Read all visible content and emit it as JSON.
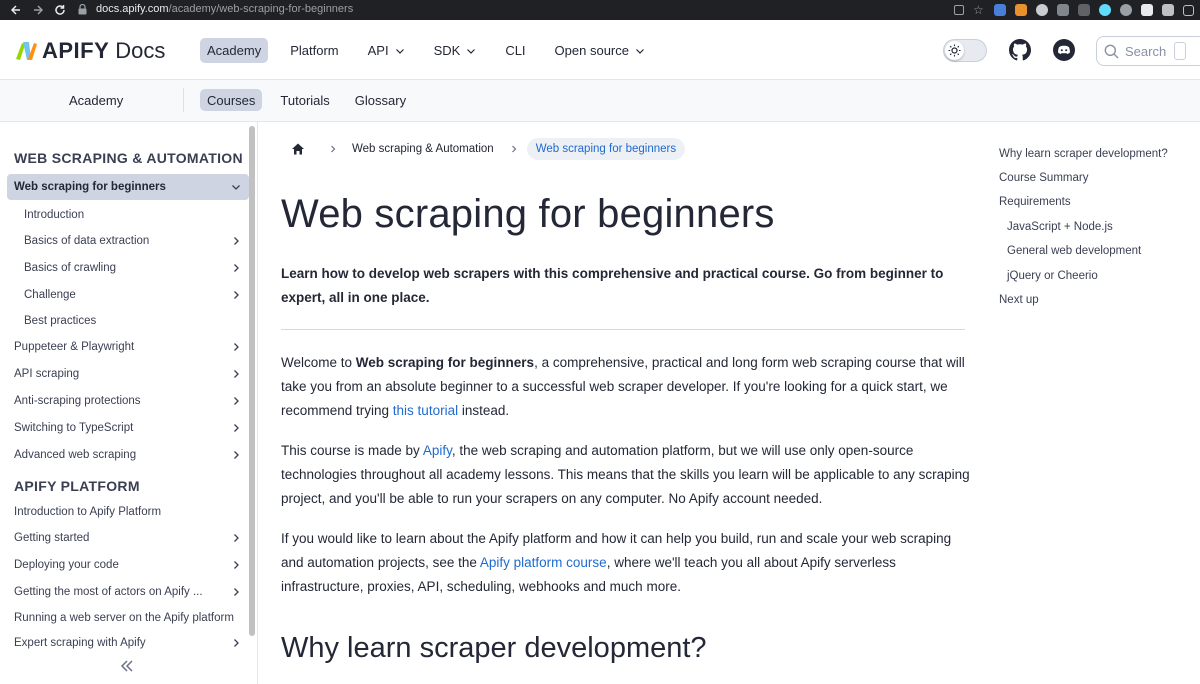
{
  "browser": {
    "url_host": "docs.apify.com",
    "url_path": "/academy/web-scraping-for-beginners"
  },
  "navbar": {
    "logo_text": "APIFY",
    "logo_docs": "Docs",
    "items": [
      {
        "label": "Academy",
        "dropdown": false
      },
      {
        "label": "Platform",
        "dropdown": false
      },
      {
        "label": "API",
        "dropdown": true
      },
      {
        "label": "SDK",
        "dropdown": true
      },
      {
        "label": "CLI",
        "dropdown": false
      },
      {
        "label": "Open source",
        "dropdown": true
      }
    ],
    "search_placeholder": "Search"
  },
  "subnav": {
    "title": "Academy",
    "items": [
      "Courses",
      "Tutorials",
      "Glossary"
    ]
  },
  "sidebar": {
    "section1": "WEB SCRAPING & AUTOMATION",
    "section2": "APIFY PLATFORM",
    "items": [
      {
        "label": "Web scraping for beginners"
      },
      {
        "label": "Introduction"
      },
      {
        "label": "Basics of data extraction"
      },
      {
        "label": "Basics of crawling"
      },
      {
        "label": "Challenge"
      },
      {
        "label": "Best practices"
      },
      {
        "label": "Puppeteer & Playwright"
      },
      {
        "label": "API scraping"
      },
      {
        "label": "Anti-scraping protections"
      },
      {
        "label": "Switching to TypeScript"
      },
      {
        "label": "Advanced web scraping"
      },
      {
        "label": "Introduction to Apify Platform"
      },
      {
        "label": "Getting started"
      },
      {
        "label": "Deploying your code"
      },
      {
        "label": "Getting the most of actors on Apify ..."
      },
      {
        "label": "Running a web server on the Apify platform"
      },
      {
        "label": "Expert scraping with Apify"
      }
    ]
  },
  "breadcrumbs": {
    "section": "Web scraping & Automation",
    "current": "Web scraping for beginners"
  },
  "content": {
    "title": "Web scraping for beginners",
    "lead": "Learn how to develop web scrapers with this comprehensive and practical course. Go from beginner to expert, all in one place.",
    "p1_a": "Welcome to ",
    "p1_b": "Web scraping for beginners",
    "p1_c": ", a comprehensive, practical and long form web scraping course that will take you from an absolute beginner to a successful web scraper developer. If you're looking for a quick start, we recommend trying ",
    "p1_link": "this tutorial",
    "p1_d": " instead.",
    "p2_a": "This course is made by ",
    "p2_link": "Apify",
    "p2_b": ", the web scraping and automation platform, but we will use only open-source technologies throughout all academy lessons. This means that the skills you learn will be applicable to any scraping project, and you'll be able to run your scrapers on any computer. No Apify account needed.",
    "p3_a": "If you would like to learn about the Apify platform and how it can help you build, run and scale your web scraping and automation projects, see the ",
    "p3_link": "Apify platform course",
    "p3_b": ", where we'll teach you all about Apify serverless infrastructure, proxies, API, scheduling, webhooks and much more.",
    "h2": "Why learn scraper development?"
  },
  "toc": {
    "items": [
      "Why learn scraper development?",
      "Course Summary",
      "Requirements",
      "JavaScript + Node.js",
      "General web development",
      "jQuery or Cheerio",
      "Next up"
    ]
  },
  "colors": {
    "accent_active_bg": "#cfd4e3",
    "link": "#1e6bd1",
    "text": "#242736"
  }
}
